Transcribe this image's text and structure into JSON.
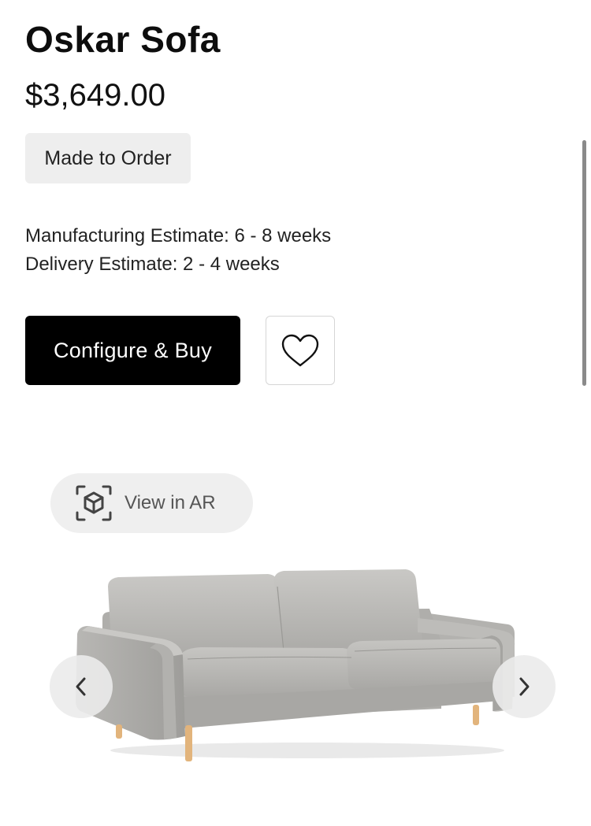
{
  "product": {
    "name": "Oskar Sofa",
    "price": "$3,649.00",
    "badge": "Made to Order",
    "manufacturing_estimate": "Manufacturing Estimate: 6 - 8 weeks",
    "delivery_estimate": "Delivery Estimate: 2 - 4 weeks"
  },
  "actions": {
    "configure_buy_label": "Configure & Buy",
    "favorite_icon": "heart-icon",
    "view_ar_label": "View in AR",
    "view_ar_icon": "ar-cube-icon"
  },
  "carousel": {
    "prev_icon": "chevron-left-icon",
    "next_icon": "chevron-right-icon"
  },
  "colors": {
    "primary_button": "#000000",
    "badge_bg": "#eeeeee",
    "ar_button_bg": "#efefef",
    "sofa_upholstery": "#b9b8b5",
    "sofa_legs": "#e2b47c"
  }
}
